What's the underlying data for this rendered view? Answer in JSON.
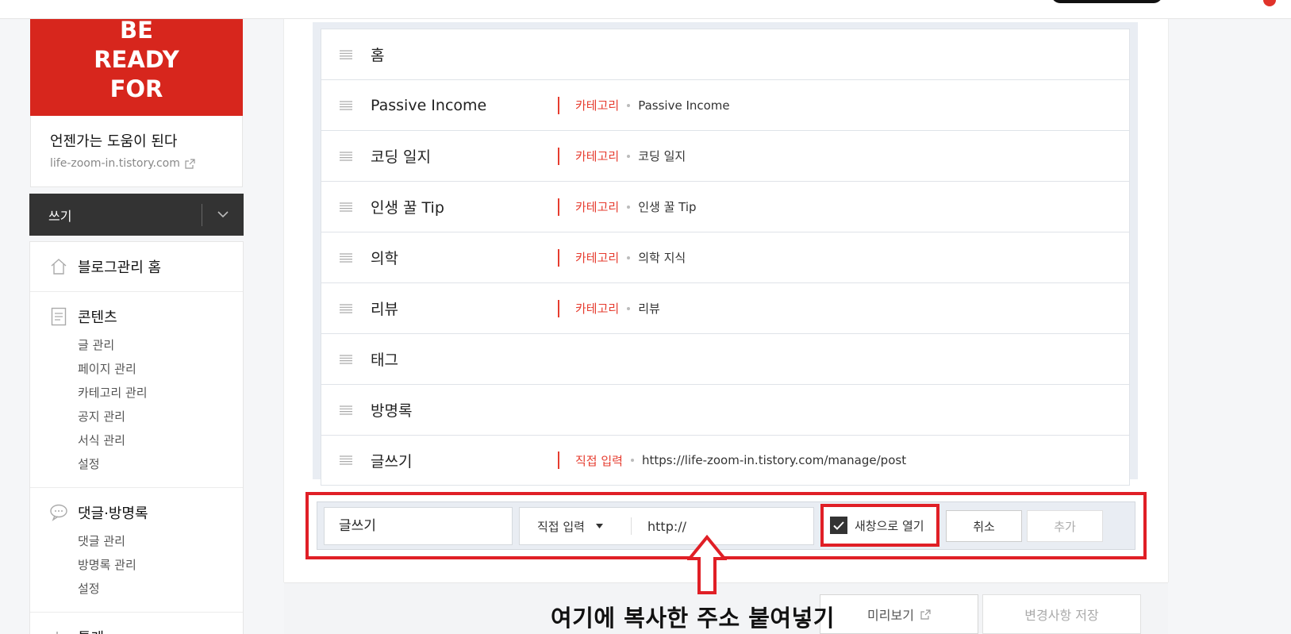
{
  "sidebar": {
    "banner_lines": [
      "BE",
      "READY",
      "FOR"
    ],
    "blog_title": "언젠가는 도움이 된다",
    "blog_url": "life-zoom-in.tistory.com",
    "write_label": "쓰기",
    "home_label": "블로그관리 홈",
    "contents": {
      "title": "콘텐츠",
      "items": [
        "글 관리",
        "페이지 관리",
        "카테고리 관리",
        "공지 관리",
        "서식 관리",
        "설정"
      ]
    },
    "comments": {
      "title": "댓글·방명록",
      "items": [
        "댓글 관리",
        "방명록 관리",
        "설정"
      ]
    },
    "stats_title": "통계"
  },
  "menu_rows": [
    {
      "name": "홈",
      "type": "",
      "target": ""
    },
    {
      "name": "Passive Income",
      "type": "카테고리",
      "target": "Passive Income"
    },
    {
      "name": "코딩 일지",
      "type": "카테고리",
      "target": "코딩 일지"
    },
    {
      "name": "인생 꿀 Tip",
      "type": "카테고리",
      "target": "인생 꿀 Tip"
    },
    {
      "name": "의학",
      "type": "카테고리",
      "target": "의학 지식"
    },
    {
      "name": "리뷰",
      "type": "카테고리",
      "target": "리뷰"
    },
    {
      "name": "태그",
      "type": "",
      "target": ""
    },
    {
      "name": "방명록",
      "type": "",
      "target": ""
    },
    {
      "name": "글쓰기",
      "type": "직접 입력",
      "target": "https://life-zoom-in.tistory.com/manage/post"
    }
  ],
  "add_form": {
    "name_value": "글쓰기",
    "type_value": "직접 입력",
    "url_value": "http://",
    "new_window_label": "새창으로 열기",
    "new_window_checked": true,
    "cancel_label": "취소",
    "add_label": "추가"
  },
  "footer": {
    "preview_label": "미리보기",
    "save_label": "변경사항 저장"
  },
  "annotation": {
    "callout_text": "여기에 복사한 주소 붙여넣기",
    "highlight_color": "#e01f26"
  },
  "colors": {
    "brand_red": "#d7261d",
    "category_red": "#e63c2f"
  }
}
